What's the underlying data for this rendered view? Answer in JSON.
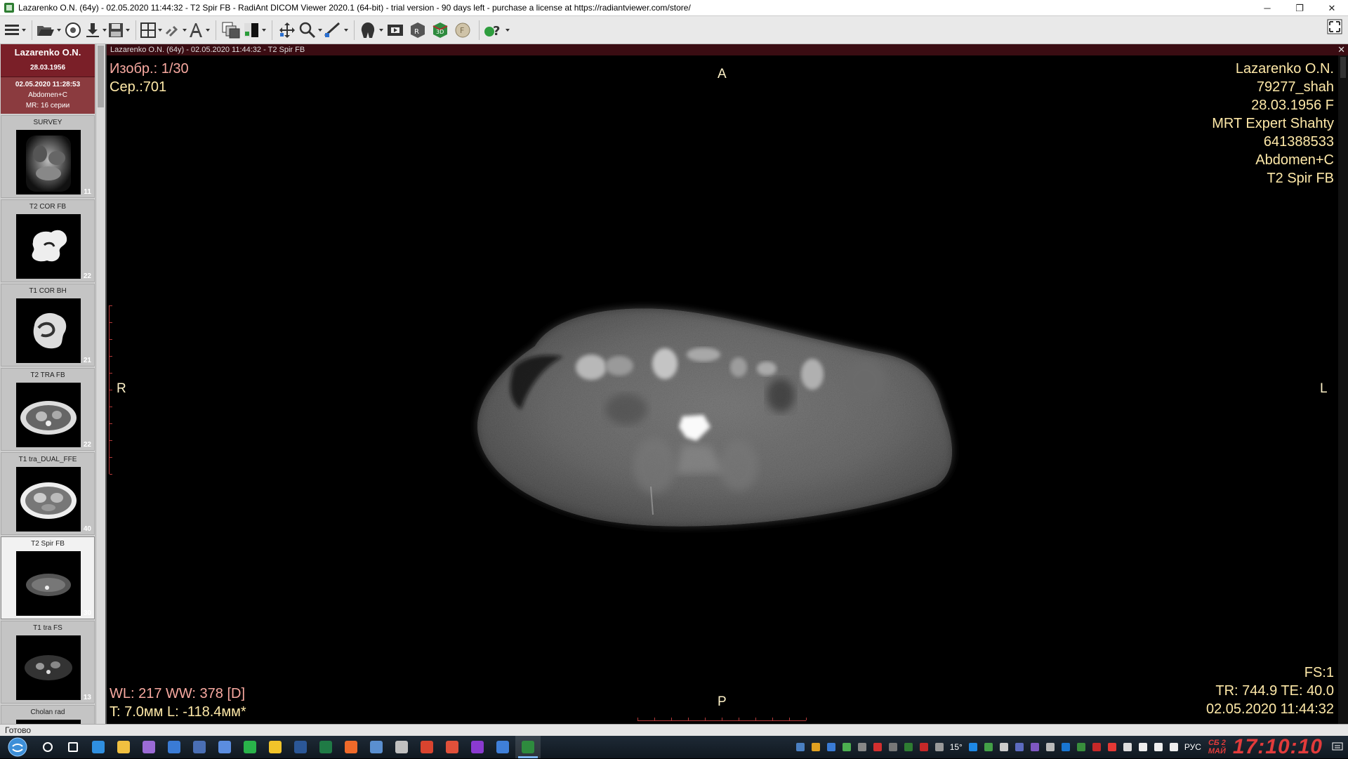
{
  "window": {
    "title": "Lazarenko O.N. (64y) - 02.05.2020 11:44:32 - T2 Spir FB - RadiAnt DICOM Viewer 2020.1 (64-bit) - trial version - 90 days left - purchase a license at https://radiantviewer.com/store/",
    "minimize": "─",
    "maximize": "❐",
    "close": "✕"
  },
  "patient": {
    "name": "Lazarenko O.N.",
    "dob": "28.03.1956"
  },
  "study": {
    "date": "02.05.2020 11:28:53",
    "description": "Abdomen+C",
    "summary": "MR: 16 серии"
  },
  "series": [
    {
      "label": "SURVEY",
      "count": "11",
      "active": false
    },
    {
      "label": "T2 COR FB",
      "count": "22",
      "active": false
    },
    {
      "label": "T1 COR BH",
      "count": "21",
      "active": false
    },
    {
      "label": "T2 TRA FB",
      "count": "22",
      "active": false
    },
    {
      "label": "T1 tra_DUAL_FFE",
      "count": "40",
      "active": false
    },
    {
      "label": "T2 Spir FB",
      "count": "30",
      "active": true
    },
    {
      "label": "T1 tra FS",
      "count": "13",
      "active": false
    },
    {
      "label": "Cholan rad",
      "count": "",
      "active": false
    }
  ],
  "viewport": {
    "header": "Lazarenko O.N. (64y) - 02.05.2020 11:44:32 - T2 Spir FB",
    "close": "✕",
    "top_left": {
      "image": "Изобр.: 1/30",
      "series": "Сер.:701"
    },
    "top_right": [
      "Lazarenko O.N.",
      "79277_shah",
      "28.03.1956 F",
      "MRT Expert Shahty",
      "641388533",
      "Abdomen+C",
      "T2 Spir FB"
    ],
    "orientation": {
      "top": "A",
      "bottom": "P",
      "left": "R",
      "right": "L"
    },
    "bottom_left": {
      "window": "WL: 217 WW: 378 [D]",
      "thickness": "T: 7.0мм L: -118.4мм*"
    },
    "bottom_right": {
      "fs": "FS:1",
      "tr_te": "TR: 744.9 TE: 40.0",
      "datetime": "02.05.2020 11:44:32"
    }
  },
  "status": {
    "text": "Готово"
  },
  "taskbar": {
    "apps": [
      {
        "name": "search",
        "color": "#ffffff"
      },
      {
        "name": "task-view",
        "color": "#ffffff"
      },
      {
        "name": "edge",
        "color": "#2f8fe0"
      },
      {
        "name": "explorer",
        "color": "#f0c040"
      },
      {
        "name": "visual-studio",
        "color": "#9b6bd6"
      },
      {
        "name": "mail",
        "color": "#3a7bd5"
      },
      {
        "name": "save",
        "color": "#4a6fb5"
      },
      {
        "name": "browser",
        "color": "#5b8de0"
      },
      {
        "name": "green-app",
        "color": "#29b34a"
      },
      {
        "name": "notes",
        "color": "#f2c42a"
      },
      {
        "name": "word",
        "color": "#2b5797"
      },
      {
        "name": "excel",
        "color": "#1f7a45"
      },
      {
        "name": "firefox",
        "color": "#f06a2a"
      },
      {
        "name": "network",
        "color": "#5a8fd0"
      },
      {
        "name": "media",
        "color": "#c0c0c0"
      },
      {
        "name": "chrome",
        "color": "#d9442f"
      },
      {
        "name": "tool",
        "color": "#e0503a"
      },
      {
        "name": "purple-app",
        "color": "#8a3ad0"
      },
      {
        "name": "app-blue",
        "color": "#3f7fd9"
      },
      {
        "name": "radiant",
        "color": "#2e8b3e"
      }
    ],
    "tray_temp": "15°",
    "tray_lang": "РУС",
    "clock_date_line1": "СБ 2",
    "clock_date_line2": "МАЙ",
    "clock_time": "17:10:10"
  }
}
